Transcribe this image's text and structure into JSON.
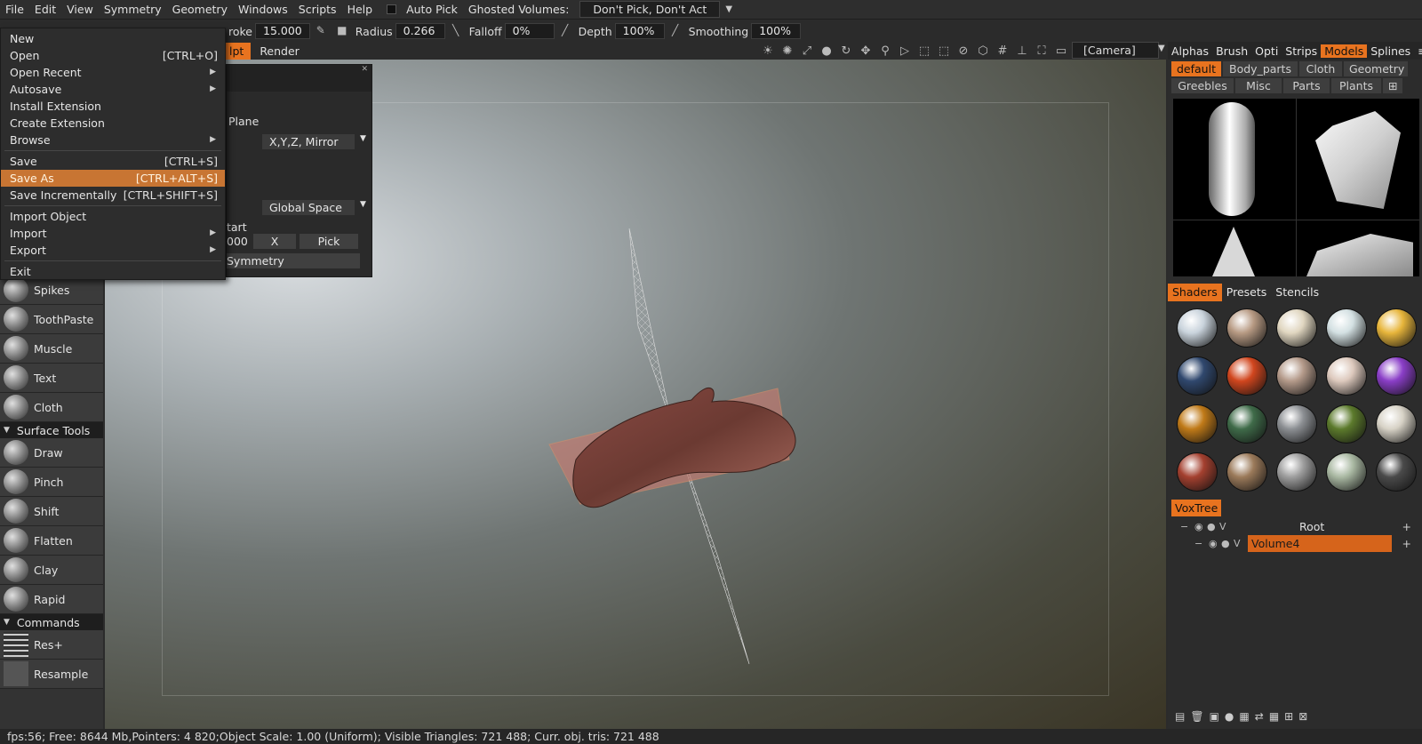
{
  "menubar": {
    "items": [
      "File",
      "Edit",
      "View",
      "Symmetry",
      "Geometry",
      "Windows",
      "Scripts",
      "Help"
    ],
    "auto_pick": "Auto Pick",
    "ghosted_label": "Ghosted Volumes:",
    "ghosted_value": "Don't Pick, Don't Act"
  },
  "toolbar": {
    "stroke_label": "roke",
    "stroke_value": "15.000",
    "radius_label": "Radius",
    "radius_value": "0.266",
    "falloff_label": "Falloff",
    "falloff_value": "0%",
    "depth_label": "Depth",
    "depth_value": "100%",
    "smoothing_label": "Smoothing",
    "smoothing_value": "100%",
    "tab_sculpt": "lpt",
    "tab_render": "Render",
    "camera": "[Camera]"
  },
  "file_menu": {
    "items": [
      {
        "label": "New",
        "shortcut": ""
      },
      {
        "label": "Open",
        "shortcut": "[CTRL+O]"
      },
      {
        "label": "Open Recent",
        "shortcut": ""
      },
      {
        "label": "Autosave",
        "shortcut": ""
      },
      {
        "label": "Install Extension",
        "shortcut": ""
      },
      {
        "label": "Create Extension",
        "shortcut": ""
      },
      {
        "label": "Browse",
        "shortcut": ""
      },
      {
        "label": "Save",
        "shortcut": "[CTRL+S]"
      },
      {
        "label": "Save As",
        "shortcut": "[CTRL+ALT+S]"
      },
      {
        "label": "Save Incrementally",
        "shortcut": "[CTRL+SHIFT+S]"
      },
      {
        "label": "Import Object",
        "shortcut": ""
      },
      {
        "label": "Import",
        "shortcut": ""
      },
      {
        "label": "Export",
        "shortcut": ""
      },
      {
        "label": "Exit",
        "shortcut": ""
      }
    ]
  },
  "symmetry_panel": {
    "plane_label": "Plane",
    "mirror_value": "X,Y,Z, Mirror",
    "space_value": "Global Space",
    "start_label": "tart",
    "start_value": "000",
    "x_button": "X",
    "pick_button": "Pick",
    "symmetry_button": "Symmetry"
  },
  "left_panel": {
    "tools_top": [
      "Spikes",
      "ToothPaste",
      "Muscle",
      "Text",
      "Cloth"
    ],
    "surface_section": "Surface Tools",
    "surface_tools": [
      "Draw",
      "Pinch",
      "Shift",
      "Flatten",
      "Clay",
      "Rapid"
    ],
    "commands_section": "Commands",
    "commands": [
      "Res+",
      "Resample"
    ]
  },
  "right_panel": {
    "tabs": [
      "Alphas",
      "Brush",
      "Opti",
      "Strips",
      "Models",
      "Splines"
    ],
    "active_tab": "Models",
    "categories": [
      "default",
      "Body_parts",
      "Cloth",
      "Geometry",
      "Greebles",
      "Misc",
      "Parts",
      "Plants"
    ],
    "active_category": "default",
    "shader_tabs": [
      "Shaders",
      "Presets",
      "Stencils"
    ],
    "shader_colors": [
      "#c9d3dc",
      "#b79a83",
      "#e0d6c0",
      "#d3e0e2",
      "#e7b53b",
      "#30486e",
      "#d1461e",
      "#b49a8a",
      "#ddc9bd",
      "#8a3ec7",
      "#c07a18",
      "#3f6b49",
      "#8c8f93",
      "#5c7a2c",
      "#d7d2c6",
      "#a4402f",
      "#9b7a5a",
      "#9d9d9d",
      "#a9b8a2",
      "#4a4a4a"
    ],
    "voxtree_tab": "VoxTree",
    "root_label": "Root",
    "volume_label": "Volume4"
  },
  "status": {
    "text": "fps:56;     Free: 8644 Mb,Pointers: 4 820;Object Scale: 1.00 (Uniform); Visible Triangles: 721 488; Curr. obj. tris: 721 488"
  },
  "colors": {
    "accent": "#e8731f",
    "menu_highlight": "#c87533"
  }
}
